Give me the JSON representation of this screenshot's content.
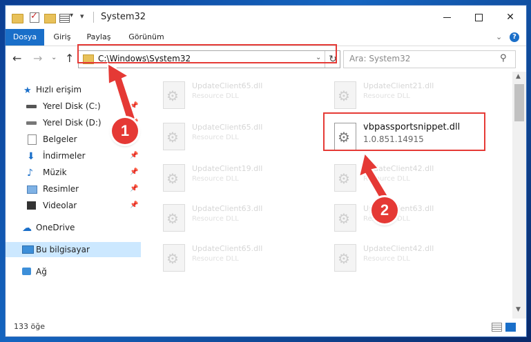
{
  "window": {
    "title": "System32"
  },
  "ribbon": {
    "tabs": [
      "Dosya",
      "Giriş",
      "Paylaş",
      "Görünüm"
    ]
  },
  "nav": {
    "address": "C:\\Windows\\System32",
    "search_placeholder": "Ara: System32"
  },
  "sidebar": {
    "quick_access": "Hızlı erişim",
    "items": [
      {
        "label": "Yerel Disk (C:)",
        "icon": "disk-icon"
      },
      {
        "label": "Yerel Disk (D:)",
        "icon": "disk-icon"
      },
      {
        "label": "Belgeler",
        "icon": "documents-icon"
      },
      {
        "label": "İndirmeler",
        "icon": "downloads-icon"
      },
      {
        "label": "Müzik",
        "icon": "music-icon"
      },
      {
        "label": "Resimler",
        "icon": "pictures-icon"
      },
      {
        "label": "Videolar",
        "icon": "videos-icon"
      }
    ],
    "onedrive": "OneDrive",
    "this_pc": "Bu bilgisayar",
    "network": "Ağ"
  },
  "files": [
    {
      "name": "UpdateClient65.dll",
      "sub": "Resource DLL"
    },
    {
      "name": "UpdateClient21.dll",
      "sub": "Resource DLL"
    },
    {
      "name": "UpdateClient65.dll",
      "sub": "Resource DLL"
    },
    {
      "name": "vbpassportsnippet.dll",
      "sub": "1.0.851.14915"
    },
    {
      "name": "UpdateClient19.dll",
      "sub": "Resource DLL"
    },
    {
      "name": "UpdateClient42.dll",
      "sub": "Resource DLL"
    },
    {
      "name": "UpdateClient63.dll",
      "sub": "Resource DLL"
    },
    {
      "name": "UpdateClient63.dll",
      "sub": "Resource DLL"
    },
    {
      "name": "UpdateClient65.dll",
      "sub": "Resource DLL"
    },
    {
      "name": "UpdateClient42.dll",
      "sub": "Resource DLL"
    }
  ],
  "status": {
    "count": "133 öğe"
  },
  "annotations": {
    "step1": "1",
    "step2": "2",
    "color": "#e53935"
  }
}
